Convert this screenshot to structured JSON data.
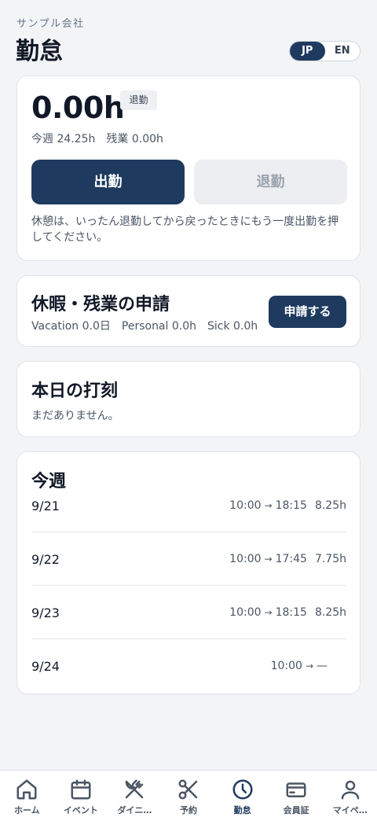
{
  "header": {
    "company": "サンプル会社",
    "title": "勤怠",
    "lang": {
      "jp": "JP",
      "en": "EN",
      "selected": "JP"
    }
  },
  "today": {
    "hours": "0.00h",
    "status_badge": "退勤",
    "week_label": "今週 24.25h",
    "overtime_label": "残業 0.00h",
    "clock_in_label": "出勤",
    "clock_out_label": "退勤",
    "note": "休憩は、いったん退勤してから戻ったときにもう一度出勤を押してください。"
  },
  "requests": {
    "title": "休暇・残業の申請",
    "vacation": "Vacation 0.0日",
    "personal": "Personal 0.0h",
    "sick": "Sick 0.0h",
    "apply_label": "申請する"
  },
  "punches": {
    "title": "本日の打刻",
    "empty_text": "まだありません。"
  },
  "week": {
    "title": "今週",
    "rows": [
      {
        "date": "9/21",
        "start": "10:00",
        "end": "18:15",
        "duration": "8.25h"
      },
      {
        "date": "9/22",
        "start": "10:00",
        "end": "17:45",
        "duration": "7.75h"
      },
      {
        "date": "9/23",
        "start": "10:00",
        "end": "18:15",
        "duration": "8.25h"
      },
      {
        "date": "9/24",
        "start": "10:00",
        "end": "—",
        "duration": ""
      }
    ],
    "arrow": "→"
  },
  "nav": {
    "active": "勤怠",
    "items": [
      {
        "label": "ホーム",
        "icon": "home-icon"
      },
      {
        "label": "イベント",
        "icon": "calendar-icon"
      },
      {
        "label": "ダイニ…",
        "icon": "dining-icon"
      },
      {
        "label": "予約",
        "icon": "scissors-icon"
      },
      {
        "label": "勤怠",
        "icon": "clock-icon"
      },
      {
        "label": "会員証",
        "icon": "card-icon"
      },
      {
        "label": "マイペ…",
        "icon": "user-icon"
      }
    ]
  },
  "colors": {
    "primary": "#1e3a5f",
    "background": "#f3f4f6",
    "card": "#ffffff"
  }
}
